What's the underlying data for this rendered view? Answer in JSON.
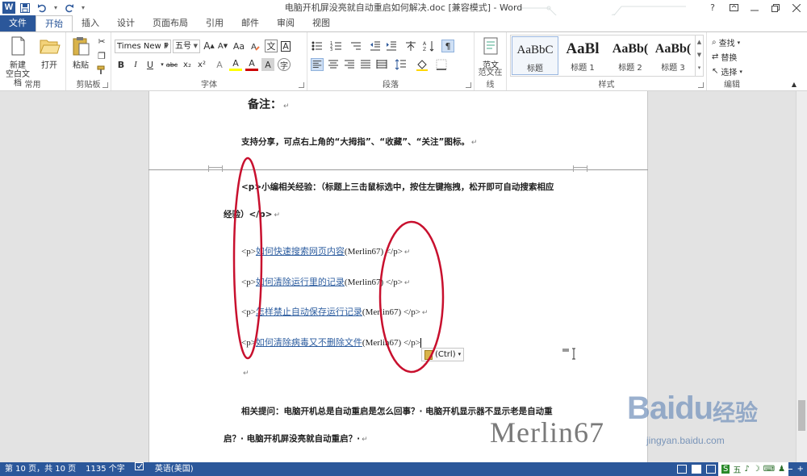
{
  "title_bar": {
    "document_title": "电脑开机屏没亮就自动重启如何解决.doc [兼容模式] - Word",
    "window_controls": [
      "?",
      "ribbon-display-icon",
      "minimize-icon",
      "restore-icon",
      "close-icon"
    ]
  },
  "quick_access": {
    "icons": [
      "word-logo-icon",
      "save-icon",
      "undo-icon",
      "redo-icon",
      "customize-icon"
    ],
    "logo_letter": "W"
  },
  "ribbon_tabs": [
    "文件",
    "开始",
    "插入",
    "设计",
    "页面布局",
    "引用",
    "邮件",
    "审阅",
    "视图"
  ],
  "active_tab": "开始",
  "ribbon": {
    "group_common": {
      "label": "常用",
      "new_blank_label": "新建\n空白文档",
      "open_label": "打开"
    },
    "group_clipboard": {
      "label": "剪贴板",
      "paste_label": "粘贴",
      "icons": [
        "cut-icon",
        "copy-icon",
        "format-painter-icon"
      ]
    },
    "group_font": {
      "label": "字体",
      "font_name": "Times New F",
      "font_size": "五号",
      "buttons": [
        "A",
        "A",
        "Aa",
        "文",
        "A"
      ],
      "format_buttons": [
        "B",
        "I",
        "U",
        "abc",
        "x₂",
        "x²",
        "A",
        "A",
        "A",
        "A",
        "字"
      ]
    },
    "group_paragraph": {
      "label": "段落"
    },
    "group_sample": {
      "label": "范文在线",
      "button_label": "范文"
    },
    "group_styles": {
      "label": "样式",
      "items": [
        {
          "sample": "AaBbC",
          "name": "标题"
        },
        {
          "sample": "AaBl",
          "name": "标题 1"
        },
        {
          "sample": "AaBb(",
          "name": "标题 2"
        },
        {
          "sample": "AaBb(",
          "name": "标题 3"
        }
      ]
    },
    "group_editing": {
      "label": "编辑",
      "find_label": "查找",
      "replace_label": "替换",
      "select_label": "选择"
    }
  },
  "document": {
    "note_heading": "备注：",
    "share_line": "支持分享，可点右上角的“大拇指”、“收藏”、“关注”图标。",
    "p_open_tag": "<p>",
    "related_intro": "小编相关经验：（标题上三击鼠标选中，按住左键拖拽，松开即可自动搜索相应",
    "related_intro_cont": "经验）</p>",
    "links": [
      {
        "prefix": "<p>",
        "text": "如何快速搜索网页内容",
        "author": "(Merlin67)",
        "suffix": " </p>"
      },
      {
        "prefix": "<p>",
        "text": "如何清除运行里的记录",
        "author": "(Merlin67)",
        "suffix": " </p>"
      },
      {
        "prefix": "<p>",
        "text": "怎样禁止自动保存运行记录",
        "author": "(Merlin67)",
        "suffix": " </p>"
      },
      {
        "prefix": "<p>",
        "text": "如何清除病毒又不删除文件",
        "author": "(Merlin67)",
        "suffix": " </p>"
      }
    ],
    "paste_options_label": "(Ctrl)",
    "questions_line1": "相关提问：电脑开机总是自动重启是怎么回事？· 电脑开机显示器不显示老是自动重",
    "questions_line2": "启？· 电脑开机屏没亮就自动重启？·",
    "paragraph_mark": "↵"
  },
  "watermark": {
    "author": "Merlin67",
    "site_logo_text": "Baidu",
    "site_logo_cn": "经验",
    "site_url": "jingyan.baidu.com"
  },
  "status_bar": {
    "page_info": "第 10 页，共 10 页",
    "word_count": "1135 个字",
    "language": "英语(美国)",
    "ime": [
      "五",
      "♪",
      "☽",
      "⌨",
      "♟"
    ]
  },
  "colors": {
    "brand_blue": "#2b579a",
    "annotation_red": "#c8102e",
    "link_blue": "#2e5ea0"
  }
}
